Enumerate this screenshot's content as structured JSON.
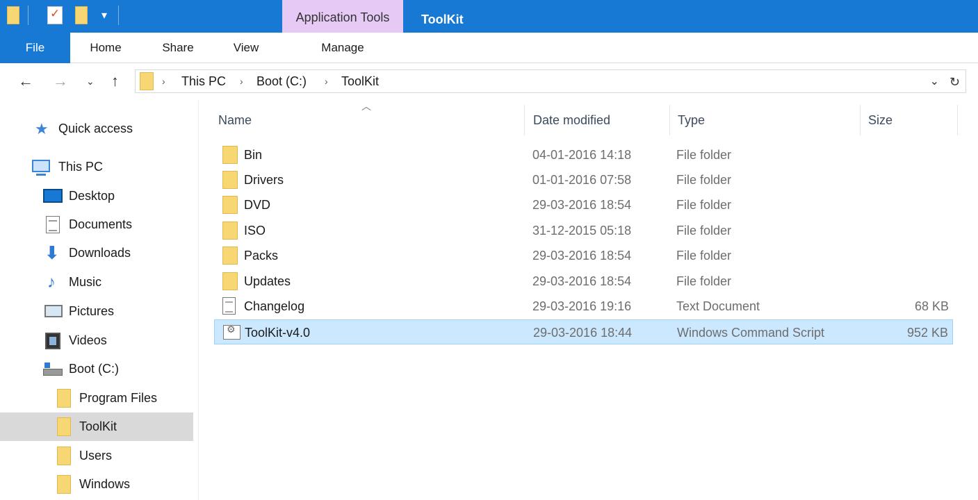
{
  "window": {
    "title": "ToolKit",
    "context_tab": "Application Tools"
  },
  "ribbon": {
    "tabs": [
      {
        "label": "File"
      },
      {
        "label": "Home"
      },
      {
        "label": "Share"
      },
      {
        "label": "View"
      },
      {
        "label": "Manage"
      }
    ]
  },
  "address": {
    "crumbs": [
      "This PC",
      "Boot (C:)",
      "ToolKit"
    ]
  },
  "sidebar": {
    "items": [
      {
        "label": "Quick access",
        "icon": "star-icon"
      },
      {
        "label": "This PC",
        "icon": "computer-icon"
      },
      {
        "label": "Desktop",
        "icon": "desktop-icon"
      },
      {
        "label": "Documents",
        "icon": "documents-icon"
      },
      {
        "label": "Downloads",
        "icon": "download-arrow-icon"
      },
      {
        "label": "Music",
        "icon": "music-note-icon"
      },
      {
        "label": "Pictures",
        "icon": "pictures-icon"
      },
      {
        "label": "Videos",
        "icon": "film-icon"
      },
      {
        "label": "Boot (C:)",
        "icon": "drive-icon"
      },
      {
        "label": "Program Files",
        "icon": "folder-icon"
      },
      {
        "label": "ToolKit",
        "icon": "folder-icon",
        "selected": true
      },
      {
        "label": "Users",
        "icon": "folder-icon"
      },
      {
        "label": "Windows",
        "icon": "folder-icon"
      }
    ]
  },
  "filelist": {
    "columns": {
      "name": "Name",
      "date": "Date modified",
      "type": "Type",
      "size": "Size"
    },
    "rows": [
      {
        "name": "Bin",
        "date": "04-01-2016 14:18",
        "type": "File folder",
        "size": "",
        "icon": "folder-icon"
      },
      {
        "name": "Drivers",
        "date": "01-01-2016 07:58",
        "type": "File folder",
        "size": "",
        "icon": "folder-icon"
      },
      {
        "name": "DVD",
        "date": "29-03-2016 18:54",
        "type": "File folder",
        "size": "",
        "icon": "folder-icon"
      },
      {
        "name": "ISO",
        "date": "31-12-2015 05:18",
        "type": "File folder",
        "size": "",
        "icon": "folder-icon"
      },
      {
        "name": "Packs",
        "date": "29-03-2016 18:54",
        "type": "File folder",
        "size": "",
        "icon": "folder-icon"
      },
      {
        "name": "Updates",
        "date": "29-03-2016 18:54",
        "type": "File folder",
        "size": "",
        "icon": "folder-icon"
      },
      {
        "name": "Changelog",
        "date": "29-03-2016 19:16",
        "type": "Text Document",
        "size": "68 KB",
        "icon": "text-document-icon"
      },
      {
        "name": "ToolKit-v4.0",
        "date": "29-03-2016 18:44",
        "type": "Windows Command Script",
        "size": "952 KB",
        "icon": "script-icon",
        "selected": true
      }
    ]
  },
  "colors": {
    "accent": "#1779d4",
    "context_tab": "#e6c9f5",
    "selected_row": "#cce8ff",
    "selected_nav": "#d9d9d9",
    "folder": "#f7d774"
  }
}
